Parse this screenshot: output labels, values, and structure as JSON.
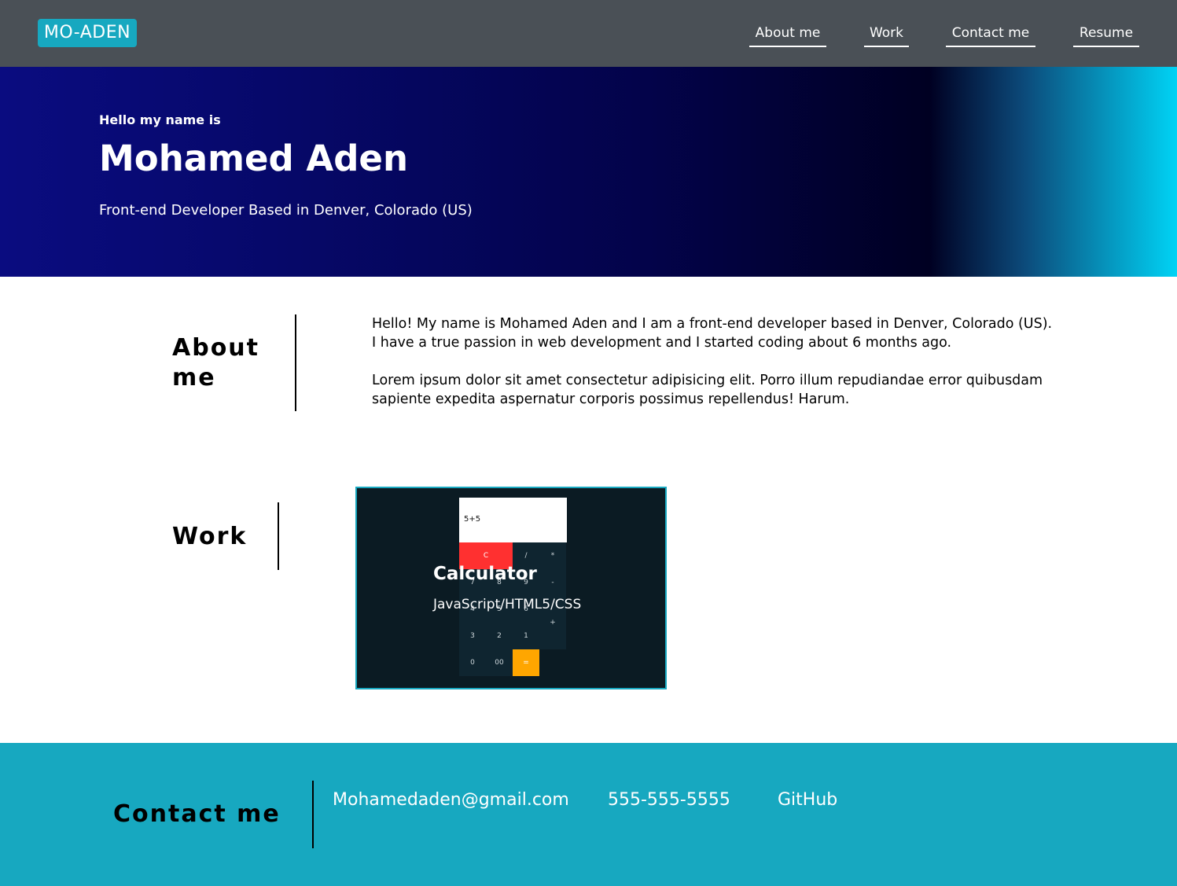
{
  "navbar": {
    "logo": "MO-ADEN",
    "links": [
      "About me",
      "Work",
      "Contact me",
      "Resume"
    ]
  },
  "hero": {
    "eyebrow": "Hello my name is",
    "name": "Mohamed Aden",
    "tagline": "Front-end Developer Based in Denver, Colorado (US)"
  },
  "about": {
    "heading_line1": "About",
    "heading_line2": "me",
    "paragraphs": [
      "Hello! My name is Mohamed Aden and I am a front-end developer based in Denver, Colorado (US). I have a true passion in web development and I started coding about 6 months ago.",
      "Lorem ipsum dolor sit amet consectetur adipisicing elit. Porro illum repudiandae error quibusdam sapiente expedita aspernatur corporis possimus repellendus! Harum."
    ]
  },
  "work": {
    "heading": "Work",
    "projects": [
      {
        "title": "Calculator",
        "stack": "JavaScript/HTML5/CSS",
        "preview": {
          "display": "5+5",
          "buttons": [
            "C",
            "/",
            "*",
            "7",
            "8",
            "9",
            "-",
            "4",
            "5",
            "6",
            "+",
            "3",
            "2",
            "1",
            "0",
            "00",
            "="
          ]
        }
      }
    ]
  },
  "contact": {
    "heading": "Contact me",
    "email": "Mohamedaden@gmail.com",
    "phone": "555-555-5555",
    "github": "GitHub"
  },
  "colors": {
    "navbar": "#4a5056",
    "accent": "#17a8c0",
    "calc_clear": "#ff3030",
    "calc_equals": "#ffa600"
  }
}
